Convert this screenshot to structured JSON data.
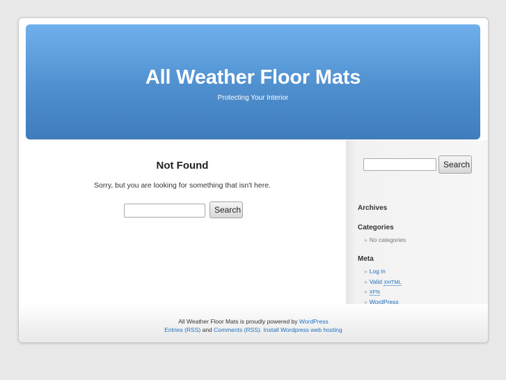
{
  "header": {
    "site_title": "All Weather Floor Mats",
    "site_description": "Protecting Your Interior"
  },
  "main": {
    "heading": "Not Found",
    "message": "Sorry, but you are looking for something that isn't here.",
    "search_value": "",
    "search_button": "Search"
  },
  "sidebar": {
    "search_value": "",
    "search_button": "Search",
    "archives_heading": "Archives",
    "categories_heading": "Categories",
    "categories_items": [
      "No categories"
    ],
    "meta_heading": "Meta",
    "meta_items": {
      "login": "Log in",
      "valid_prefix": "Valid",
      "xhtml": "XHTML",
      "xfn": "XFN",
      "wordpress": "WordPress"
    },
    "bullet": "»"
  },
  "footer": {
    "line1_text": "All Weather Floor Mats is proudly powered by",
    "line1_link": "WordPress",
    "entries_link": "Entries (RSS)",
    "and_text": "and",
    "comments_link": "Comments (RSS).",
    "hosting_link": "Install Wordpress web hosting"
  },
  "colors": {
    "header_top": "#6fb0ec",
    "header_bottom": "#3f7cbc",
    "link": "#1f6fbf",
    "background": "#e8e8e8"
  }
}
